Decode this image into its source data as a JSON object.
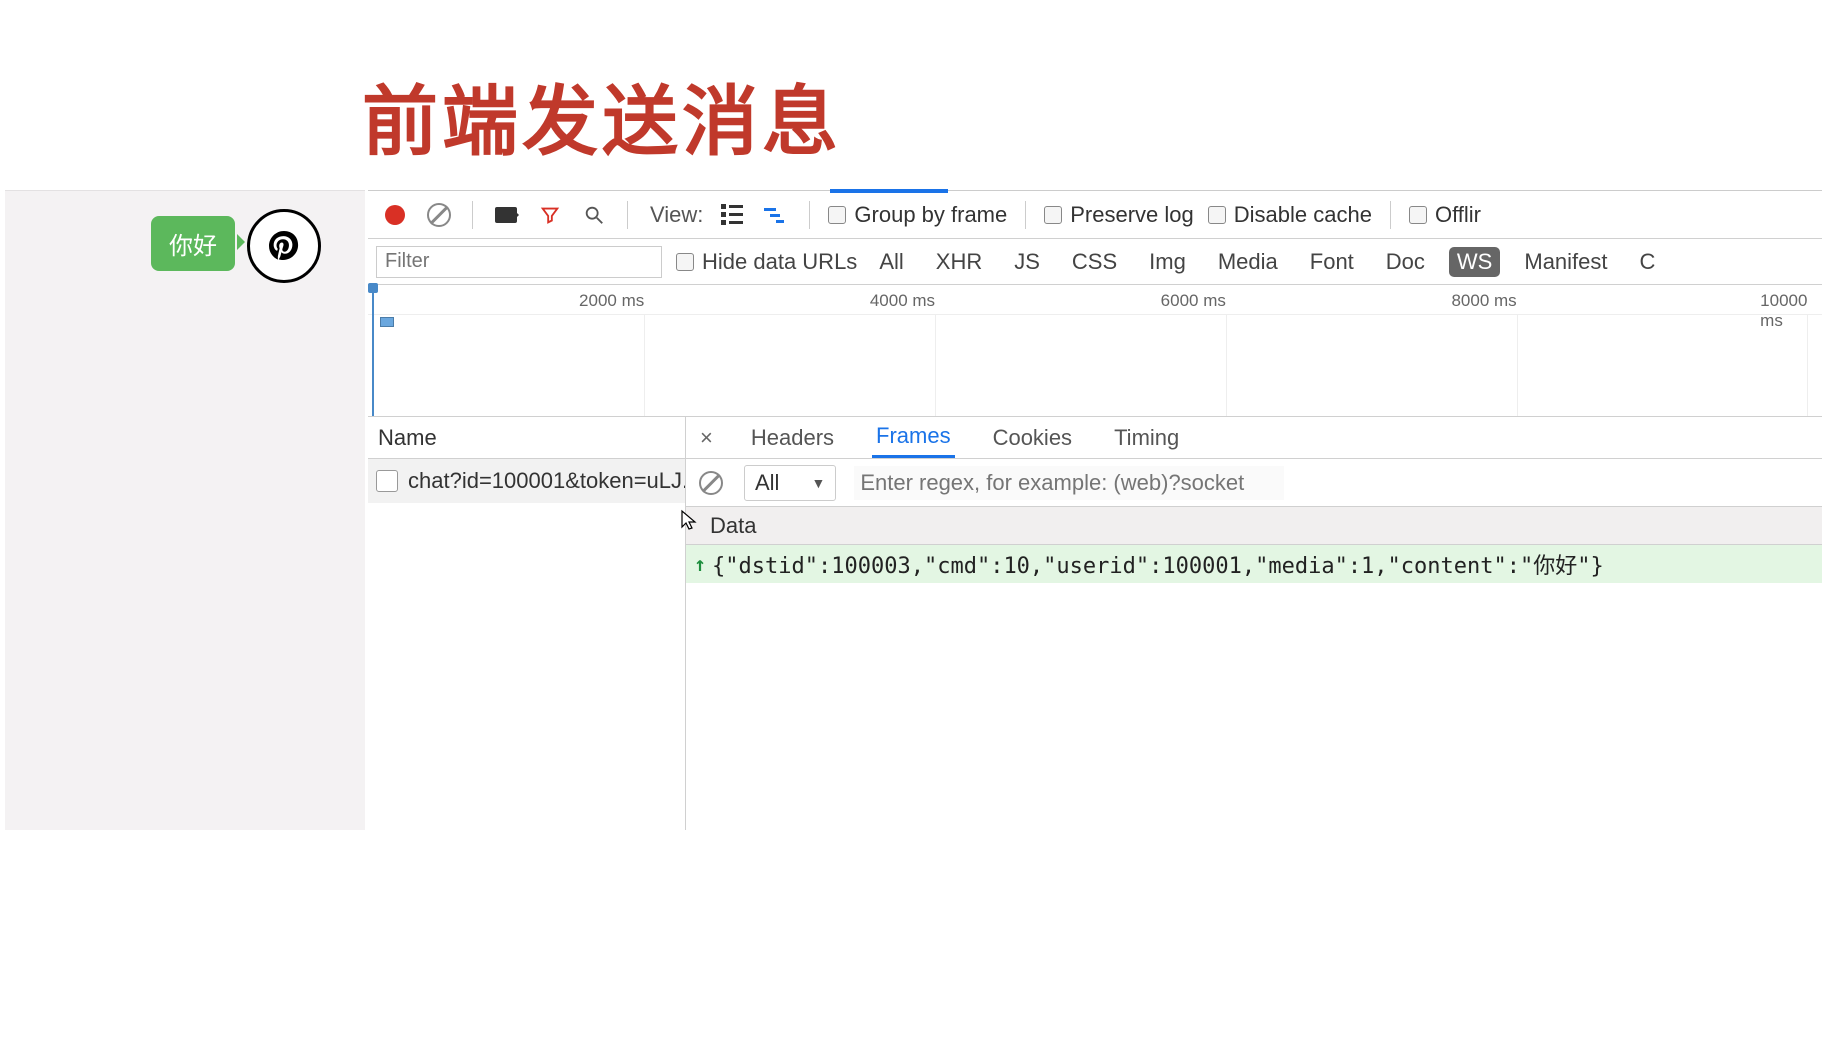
{
  "title": "前端发送消息",
  "chat": {
    "bubble_text": "你好"
  },
  "toolbar": {
    "view_label": "View:",
    "group_by_frame": "Group by frame",
    "preserve_log": "Preserve log",
    "disable_cache": "Disable cache",
    "offline": "Offlir"
  },
  "filterbar": {
    "placeholder": "Filter",
    "hide_data_urls": "Hide data URLs",
    "types": [
      "All",
      "XHR",
      "JS",
      "CSS",
      "Img",
      "Media",
      "Font",
      "Doc",
      "WS",
      "Manifest",
      "C"
    ],
    "active_type": "WS"
  },
  "timeline": {
    "ticks": [
      "2000 ms",
      "4000 ms",
      "6000 ms",
      "8000 ms",
      "10000 ms"
    ]
  },
  "name_col": {
    "header": "Name",
    "rows": [
      "chat?id=100001&token=uLJ..."
    ]
  },
  "detail": {
    "tabs": [
      "Headers",
      "Frames",
      "Cookies",
      "Timing"
    ],
    "active_tab": "Frames",
    "frame_filter": {
      "dropdown": "All",
      "regex_placeholder": "Enter regex, for example: (web)?socket"
    },
    "data_header": "Data",
    "frames": [
      {
        "direction": "up",
        "content": "{\"dstid\":100003,\"cmd\":10,\"userid\":100001,\"media\":1,\"content\":\"你好\"}"
      }
    ]
  }
}
